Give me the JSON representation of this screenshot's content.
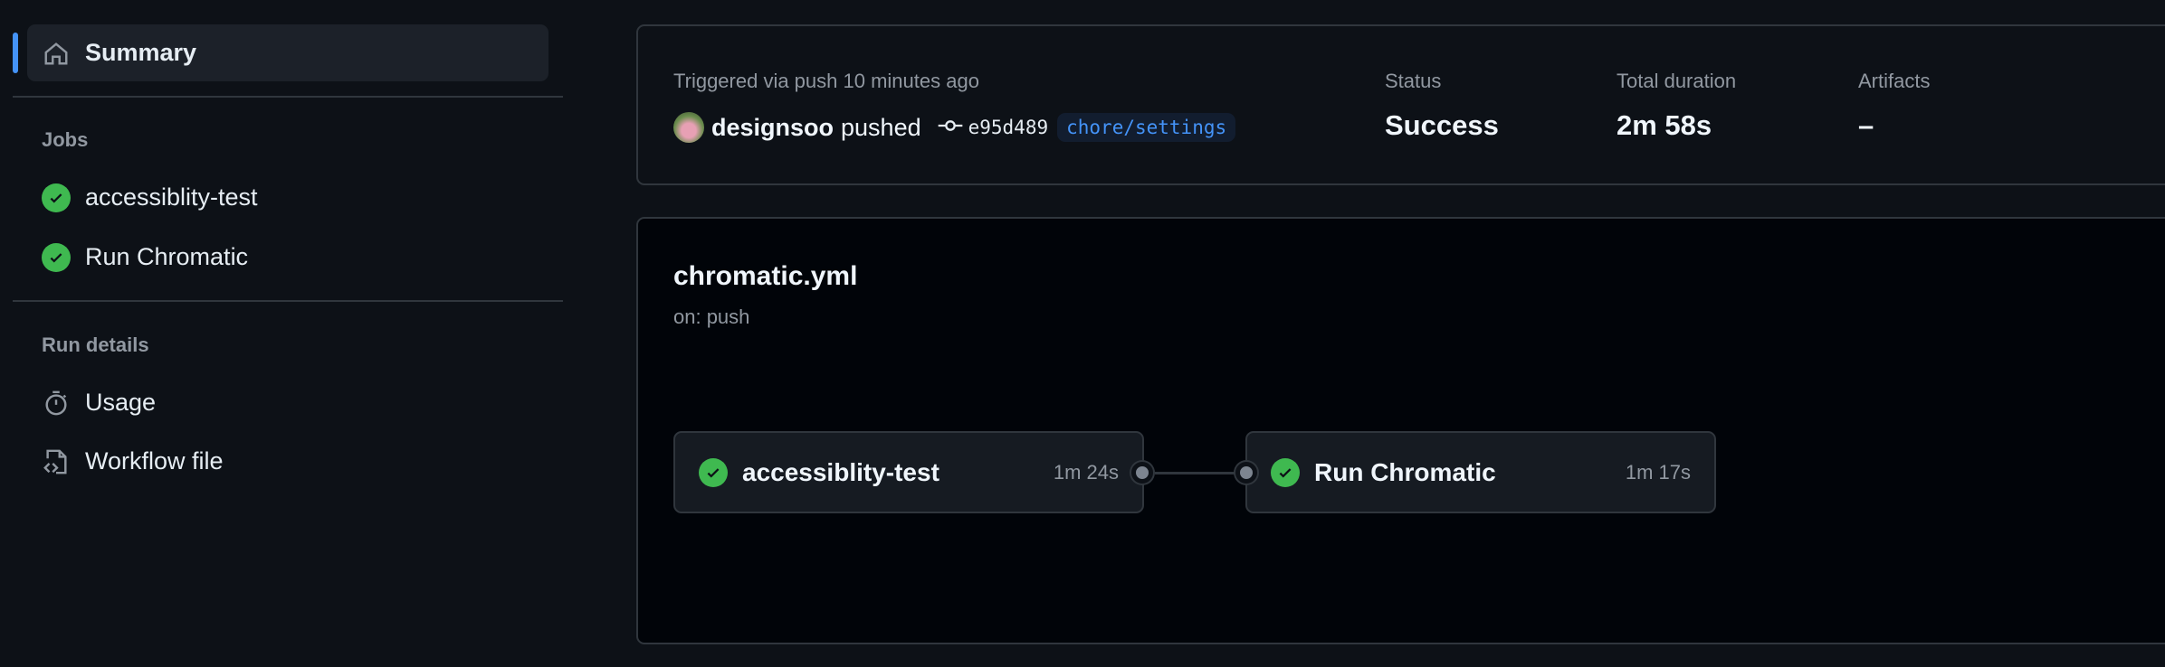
{
  "sidebar": {
    "summary": "Summary",
    "jobs_heading": "Jobs",
    "jobs": [
      {
        "label": "accessiblity-test",
        "status": "success"
      },
      {
        "label": "Run Chromatic",
        "status": "success"
      }
    ],
    "run_details_heading": "Run details",
    "run_details": [
      {
        "label": "Usage",
        "icon": "stopwatch-icon"
      },
      {
        "label": "Workflow file",
        "icon": "file-code-icon"
      }
    ]
  },
  "summary_card": {
    "trigger": "Triggered via push 10 minutes ago",
    "actor": "designsoo",
    "action": "pushed",
    "commit": "e95d489",
    "branch": "chore/settings",
    "status_label": "Status",
    "status_value": "Success",
    "duration_label": "Total duration",
    "duration_value": "2m 58s",
    "artifacts_label": "Artifacts",
    "artifacts_value": "–"
  },
  "workflow": {
    "file": "chromatic.yml",
    "trigger": "on: push",
    "jobs": [
      {
        "name": "accessiblity-test",
        "duration": "1m 24s"
      },
      {
        "name": "Run Chromatic",
        "duration": "1m 17s"
      }
    ]
  },
  "colors": {
    "accent": "#4493f8",
    "success": "#3fb950"
  }
}
